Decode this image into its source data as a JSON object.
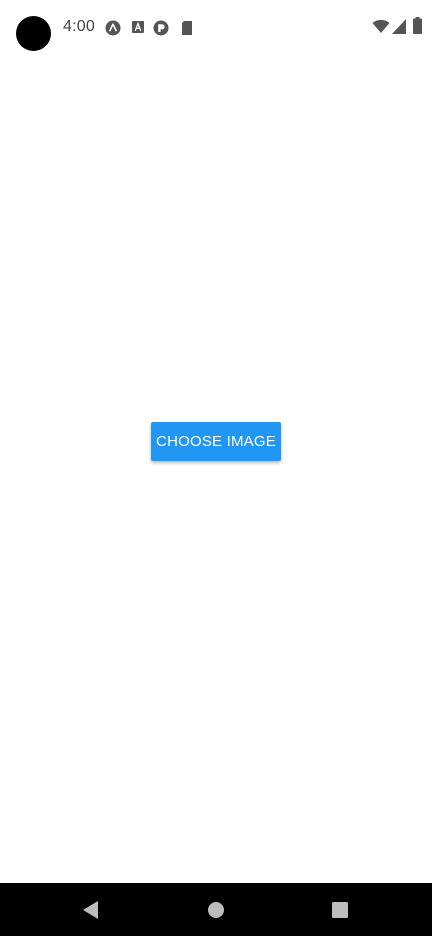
{
  "status_bar": {
    "time": "4:00",
    "notification_icons": [
      "expo-icon",
      "app-a-icon",
      "react-debug-icon",
      "sd-card-icon"
    ],
    "system_icons": [
      "wifi-icon",
      "cellular-signal-icon",
      "battery-icon"
    ]
  },
  "main": {
    "choose_image_label": "CHOOSE IMAGE"
  },
  "nav_bar": {
    "buttons": [
      "back-button",
      "home-button",
      "recents-button"
    ]
  },
  "colors": {
    "button_background": "#2196f3",
    "button_text": "#ffffff",
    "nav_bar_background": "#000000",
    "status_icon_color": "#555555"
  }
}
